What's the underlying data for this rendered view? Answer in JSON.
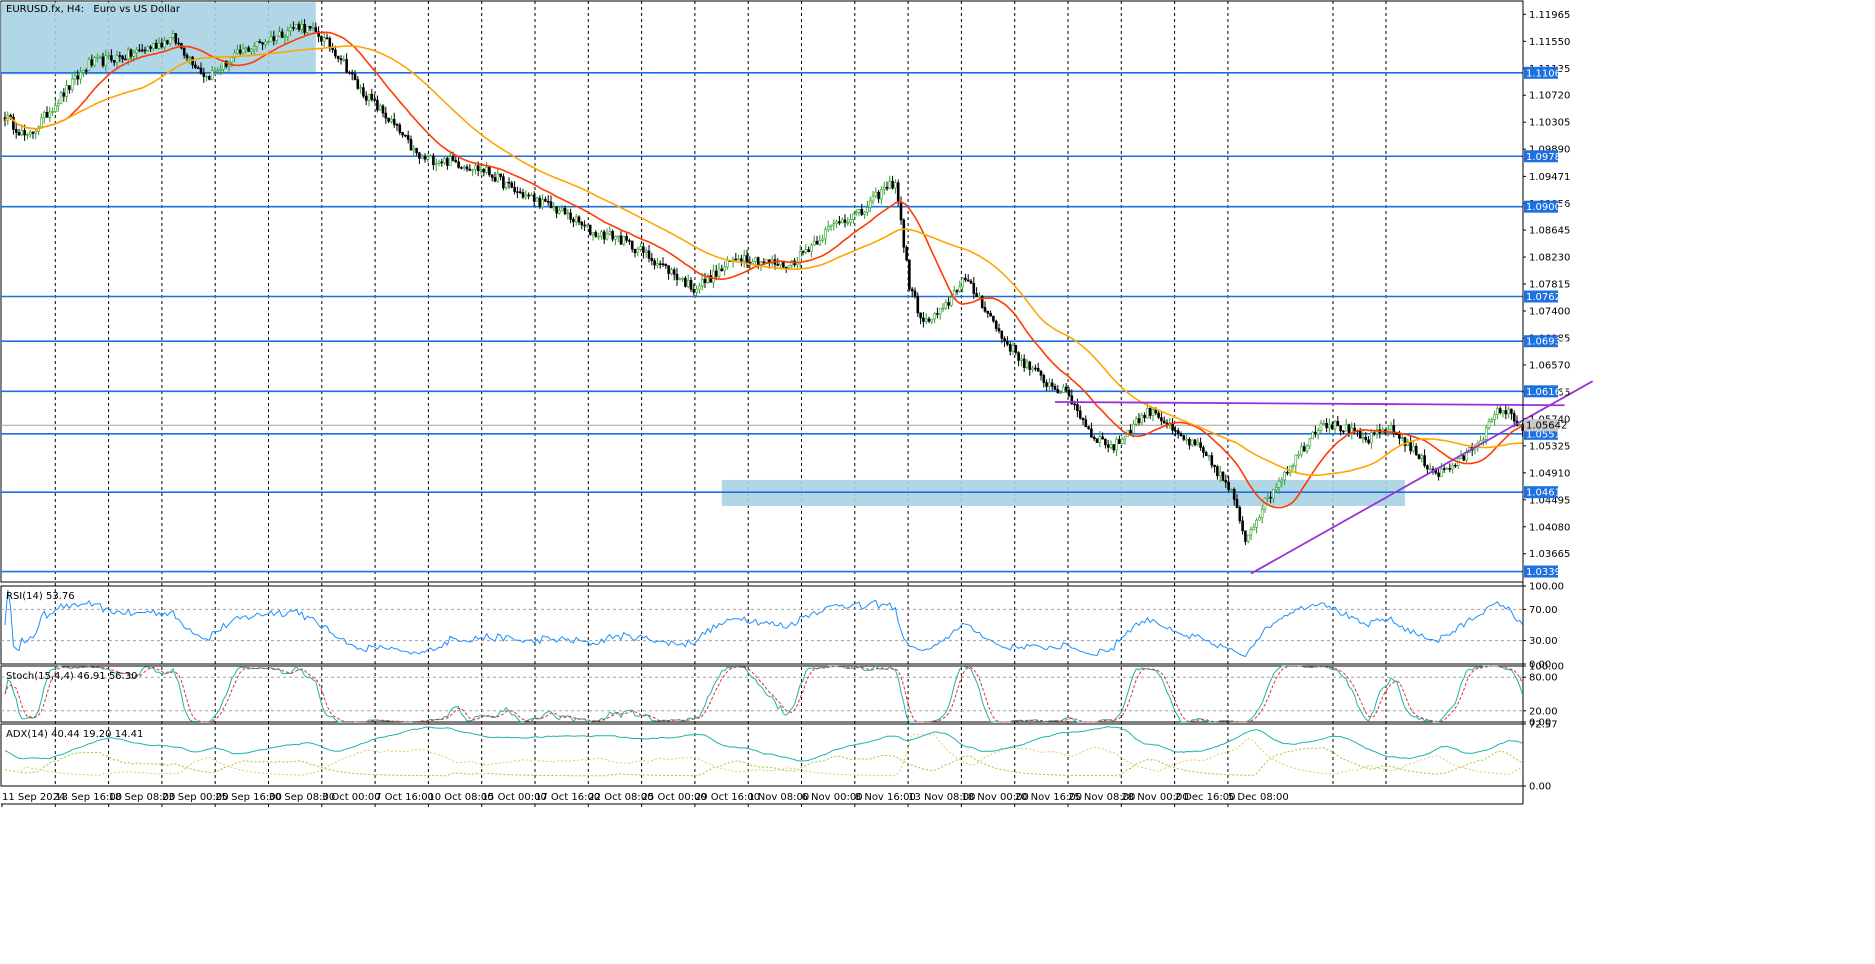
{
  "header": {
    "symbol": "EURUSD.fx, H4:",
    "description": "Euro vs US Dollar"
  },
  "colors": {
    "bull": "#2ca02c",
    "bear": "#000000",
    "ma_fast": "#ff3c00",
    "ma_slow": "#ffa500",
    "level": "#1e6fe0",
    "zone": "#a8d3e3",
    "trend": "#9b30d9",
    "rsi": "#1e90ff",
    "stoch_main": "#20b2aa",
    "stoch_signal": "#e03030",
    "adx": "#20b2aa",
    "di_plus": "#9acd32",
    "di_minus": "#e8c86a"
  },
  "chart_data": [
    {
      "type": "candlestick",
      "title": "EURUSD.fx, H4:  Euro vs US Dollar",
      "ylim": [
        1.0323,
        1.1217
      ],
      "y_ticks": [
        "1.11965",
        "1.11550",
        "1.11135",
        "1.10720",
        "1.10305",
        "1.09890",
        "1.09471",
        "1.09056",
        "1.08645",
        "1.08230",
        "1.07815",
        "1.07400",
        "1.06985",
        "1.06570",
        "1.06155",
        "1.05740",
        "1.05325",
        "1.04910",
        "1.04495",
        "1.04080",
        "1.03665"
      ],
      "x_labels": [
        "11 Sep 2024",
        "13 Sep 16:00",
        "18 Sep 08:00",
        "23 Sep 00:00",
        "25 Sep 16:00",
        "30 Sep 08:00",
        "3 Oct 00:00",
        "7 Oct 16:00",
        "10 Oct 08:00",
        "15 Oct 00:00",
        "17 Oct 16:00",
        "22 Oct 08:00",
        "25 Oct 00:00",
        "29 Oct 16:00",
        "1 Nov 08:00",
        "6 Nov 00:00",
        "8 Nov 16:00",
        "13 Nov 08:00",
        "18 Nov 00:00",
        "20 Nov 16:00",
        "25 Nov 08:00",
        "28 Nov 00:00",
        "2 Dec 16:00",
        "5 Dec 08:00"
      ],
      "anchors": [
        [
          0,
          1.104
        ],
        [
          8,
          1.1005
        ],
        [
          18,
          1.106
        ],
        [
          30,
          1.112
        ],
        [
          45,
          1.1135
        ],
        [
          60,
          1.116
        ],
        [
          72,
          1.11
        ],
        [
          85,
          1.114
        ],
        [
          95,
          1.116
        ],
        [
          105,
          1.118
        ],
        [
          112,
          1.1165
        ],
        [
          120,
          1.113
        ],
        [
          126,
          1.1085
        ],
        [
          135,
          1.1045
        ],
        [
          140,
          1.102
        ],
        [
          148,
          1.0975
        ],
        [
          160,
          1.097
        ],
        [
          172,
          1.0955
        ],
        [
          182,
          1.0925
        ],
        [
          190,
          1.091
        ],
        [
          200,
          1.089
        ],
        [
          210,
          1.086
        ],
        [
          218,
          1.0855
        ],
        [
          228,
          1.083
        ],
        [
          238,
          1.08
        ],
        [
          246,
          1.0775
        ],
        [
          255,
          1.08
        ],
        [
          262,
          1.0825
        ],
        [
          272,
          1.0815
        ],
        [
          280,
          1.081
        ],
        [
          290,
          1.085
        ],
        [
          298,
          1.088
        ],
        [
          306,
          1.089
        ],
        [
          312,
          1.092
        ],
        [
          318,
          1.094
        ],
        [
          323,
          1.078
        ],
        [
          328,
          1.072
        ],
        [
          335,
          1.074
        ],
        [
          342,
          1.079
        ],
        [
          348,
          1.076
        ],
        [
          356,
          1.07
        ],
        [
          364,
          1.066
        ],
        [
          372,
          1.063
        ],
        [
          380,
          1.061
        ],
        [
          388,
          1.055
        ],
        [
          396,
          1.053
        ],
        [
          404,
          1.057
        ],
        [
          410,
          1.059
        ],
        [
          418,
          1.055
        ],
        [
          426,
          1.053
        ],
        [
          432,
          1.05
        ],
        [
          438,
          1.046
        ],
        [
          443,
          1.039
        ],
        [
          448,
          1.043
        ],
        [
          455,
          1.048
        ],
        [
          462,
          1.052
        ],
        [
          470,
          1.057
        ],
        [
          478,
          1.056
        ],
        [
          486,
          1.054
        ],
        [
          494,
          1.056
        ],
        [
          500,
          1.054
        ],
        [
          506,
          1.051
        ],
        [
          512,
          1.049
        ],
        [
          520,
          1.051
        ],
        [
          528,
          1.055
        ],
        [
          534,
          1.059
        ],
        [
          538,
          1.058
        ],
        [
          542,
          1.056
        ]
      ],
      "n_bars": 543,
      "bull_color": "#2ca02c",
      "bear_color": "#000000",
      "current_price": "1.05642",
      "price_levels": [
        {
          "value": 1.11065,
          "label": "1.11065"
        },
        {
          "value": 1.09781,
          "label": "1.09781"
        },
        {
          "value": 1.09005,
          "label": "1.09005"
        },
        {
          "value": 1.07623,
          "label": "1.07623"
        },
        {
          "value": 1.06935,
          "label": "1.06935"
        },
        {
          "value": 1.06164,
          "label": "1.06164"
        },
        {
          "value": 1.0551,
          "label": "1.05510"
        },
        {
          "value": 1.04612,
          "label": "1.04612"
        },
        {
          "value": 1.03391,
          "label": "1.03391"
        }
      ],
      "zones": [
        {
          "from_bar": 0,
          "to_bar": 111,
          "y_top": 1.1215,
          "y_bottom": 1.1104
        },
        {
          "from_bar": 256,
          "to_bar": 500,
          "y_top": 1.048,
          "y_bottom": 1.044
        }
      ],
      "trend_lines": [
        {
          "x1": 375,
          "y1": 1.06,
          "x2": 557,
          "y2": 1.0595
        },
        {
          "x1": 445,
          "y1": 1.0336,
          "x2": 567,
          "y2": 1.0632
        }
      ],
      "moving_averages": [
        {
          "period": 20,
          "color": "#ff3c00"
        },
        {
          "period": 50,
          "color": "#ffa500"
        }
      ]
    },
    {
      "type": "line",
      "title": "RSI(14) 53.76",
      "ylim": [
        0,
        100
      ],
      "y_ticks": [
        "100.00",
        "70.00",
        "30.00",
        "0.00"
      ],
      "levels": [
        70,
        30
      ],
      "last_value": 53.76
    },
    {
      "type": "line",
      "title": "Stoch(15,4,4) 46.91 56.30",
      "ylim": [
        0,
        100
      ],
      "y_ticks": [
        "100.00",
        "80.00",
        "20.00",
        "0.00"
      ],
      "levels": [
        80,
        20
      ],
      "series": [
        {
          "name": "main",
          "last": 46.91
        },
        {
          "name": "signal",
          "last": 56.3
        }
      ]
    },
    {
      "type": "line",
      "title": "ADX(14) 40.44 19.20 14.41",
      "ylim": [
        0,
        72.57
      ],
      "y_ticks": [
        "72.57",
        "0.00"
      ],
      "series": [
        {
          "name": "ADX",
          "last": 40.44
        },
        {
          "name": "+DI",
          "last": 19.2
        },
        {
          "name": "-DI",
          "last": 14.41
        }
      ]
    }
  ]
}
